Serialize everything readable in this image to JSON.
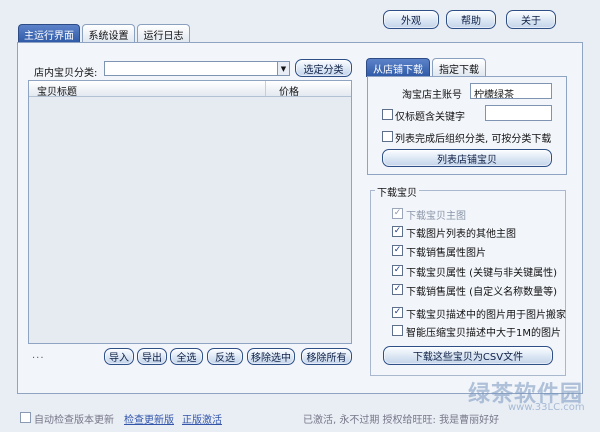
{
  "top_buttons": {
    "appearance": "外观",
    "help": "帮助",
    "about": "关于"
  },
  "tabs": [
    "主运行界面",
    "系统设置",
    "运行日志"
  ],
  "left": {
    "category_label": "店内宝贝分类:",
    "category_value": "",
    "select_category": "选定分类",
    "list_headers": {
      "title": "宝贝标题",
      "price": "价格"
    },
    "ellipsis": "...",
    "actions": [
      "导入",
      "导出",
      "全选",
      "反选",
      "移除选中",
      "移除所有"
    ]
  },
  "right_tabs": [
    "从店铺下载",
    "指定下载"
  ],
  "store": {
    "owner_label": "淘宝店主账号",
    "owner_value": "柠檬绿茶",
    "keyword_label": "仅标题含关键字",
    "keyword_checked": false,
    "keyword_value": "",
    "group_label": "列表完成后组织分类, 可按分类下载",
    "group_checked": false,
    "list_button": "列表店铺宝贝"
  },
  "download": {
    "title": "下载宝贝",
    "options": [
      {
        "label": "下载宝贝主图",
        "checked": true,
        "disabled": true
      },
      {
        "label": "下载图片列表的其他主图",
        "checked": true,
        "disabled": false
      },
      {
        "label": "下载销售属性图片",
        "checked": true,
        "disabled": false
      },
      {
        "label": "下载宝贝属性 (关键与非关键属性)",
        "checked": true,
        "disabled": false
      },
      {
        "label": "下载销售属性 (自定义名称数量等)",
        "checked": true,
        "disabled": false
      },
      {
        "label": "下载宝贝描述中的图片用于图片搬家",
        "checked": true,
        "disabled": false
      },
      {
        "label": "智能压缩宝贝描述中大于1M的图片",
        "checked": false,
        "disabled": false
      }
    ],
    "csv_button": "下载这些宝贝为CSV文件"
  },
  "footer": {
    "auto_check_label": "自动检查版本更新",
    "check_update": "检查更新版",
    "activate": "正版激活",
    "status": "已激活, 永不过期 授权给旺旺: 我是曹丽好好"
  },
  "watermark": {
    "main": "绿茶软件园",
    "sub": "www.33LC.com"
  }
}
